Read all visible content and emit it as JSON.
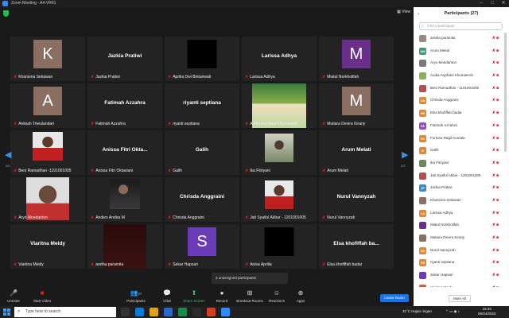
{
  "window": {
    "title": "Zoom Meeting - A4-VR61",
    "view_label": "View"
  },
  "tiles": [
    {
      "name": "Kharisma Setiawan",
      "avatar": "K",
      "avatar_color": "#8a6e62"
    },
    {
      "name": "Jazkia Pratiwi",
      "big": "Jazkia Pratiwi"
    },
    {
      "name": "Aprilia Dwi Bintariwati",
      "black": true
    },
    {
      "name": "Larissa Adhya",
      "big": "Larissa Adhya"
    },
    {
      "name": "Miatul Norkholifah",
      "avatar": "M",
      "avatar_color": "#6a2f8a"
    },
    {
      "name": "Aniisah Triwulandari",
      "avatar": "A",
      "avatar_color": "#8a6e62"
    },
    {
      "name": "Fatimah Azzahra",
      "big": "Fatimah Azzahra"
    },
    {
      "name": "riyanti septiana",
      "big": "riyanti septiana"
    },
    {
      "name": "Audia Asyifatul Khumaeroh",
      "photo": "poster"
    },
    {
      "name": "Mutiara Devira Kirany",
      "avatar": "M",
      "avatar_color": "#8a6e62"
    },
    {
      "name": "Beni Ramadhan -1191001005",
      "photo": "red-shirt"
    },
    {
      "name": "Anissa Fitri Oktaviani",
      "big": "Anissa Fitri Okta..."
    },
    {
      "name": "Galih",
      "big": "Galih"
    },
    {
      "name": "Ika Fitriyani",
      "photo": "outdoor"
    },
    {
      "name": "Arum Melati",
      "big": "Arum Melati"
    },
    {
      "name": "Aryo Moedanton",
      "photo": "man-glasses"
    },
    {
      "name": "Andien Andira M",
      "photo": "dark-room"
    },
    {
      "name": "Chrisda Anggraini",
      "big": "Chrisda Anggraini"
    },
    {
      "name": "Jati Syaiful Akbar - 1201001005",
      "photo": "red-shirt-2"
    },
    {
      "name": "Nurul Vannyzah",
      "big": "Nurul Vannyzah"
    },
    {
      "name": "Viaritna Meidy",
      "big": "Viaritna Meidy"
    },
    {
      "name": "aretha paramita",
      "photo": "dark-maroon"
    },
    {
      "name": "Sekar Hapsari",
      "avatar": "S",
      "avatar_color": "#6a3cb8"
    },
    {
      "name": "Anisa Aprilia",
      "black": true
    },
    {
      "name": "Elsa khofiffah badar",
      "big": "Elsa khofiffah ba..."
    }
  ],
  "pager": {
    "left": "2/2",
    "right": "2/2"
  },
  "toast": "3 unassigned participants",
  "toolbar": {
    "unmute": "Unmute",
    "start_video": "Start Video",
    "participants": "Participants",
    "participants_count": "27",
    "chat": "Chat",
    "share_screen": "Share Screen",
    "record": "Record",
    "breakout": "Breakout Rooms",
    "reactions": "Reactions",
    "apps": "Apps",
    "leave": "Leave Room"
  },
  "panel": {
    "title": "Participants (27)",
    "search_placeholder": "Find a participant",
    "mute_all": "Mute All",
    "participants": [
      {
        "initials": "",
        "color": "#9a8a80",
        "name": "aretha paramita"
      },
      {
        "initials": "AM",
        "color": "#3f9b6e",
        "name": "Arum Melati"
      },
      {
        "initials": "",
        "color": "#7a7a7a",
        "name": "Aryo Moedanton"
      },
      {
        "initials": "",
        "color": "#8fb05a",
        "name": "Audia Asyifatul Khumaeroh"
      },
      {
        "initials": "",
        "color": "#b05050",
        "name": "Beni Ramadhan - 1191001005"
      },
      {
        "initials": "CA",
        "color": "#e0873a",
        "name": "Chrisda Anggraini"
      },
      {
        "initials": "EB",
        "color": "#e0873a",
        "name": "Elsa khofiffah badar"
      },
      {
        "initials": "FA",
        "color": "#8e4fc0",
        "name": "Fatimah Azzahra"
      },
      {
        "initials": "FK",
        "color": "#e0873a",
        "name": "Fortuna Ragil Kumala"
      },
      {
        "initials": "G",
        "color": "#e0873a",
        "name": "Galih"
      },
      {
        "initials": "",
        "color": "#6a8a5a",
        "name": "Ika Fitriyani"
      },
      {
        "initials": "",
        "color": "#b05050",
        "name": "Jati Syaiful Akbar - 1201001005"
      },
      {
        "initials": "JP",
        "color": "#3a8ac0",
        "name": "Jazkia Pratiwi"
      },
      {
        "initials": "",
        "color": "#8a6e62",
        "name": "Kharisma Setiawan"
      },
      {
        "initials": "LA",
        "color": "#e0873a",
        "name": "Larissa Adhya"
      },
      {
        "initials": "",
        "color": "#6a2f8a",
        "name": "Miatul Norkholifah"
      },
      {
        "initials": "",
        "color": "#8a6e62",
        "name": "Mutiara Devira Kirany"
      },
      {
        "initials": "NV",
        "color": "#e0873a",
        "name": "Nurul Vannyzah"
      },
      {
        "initials": "RS",
        "color": "#e0873a",
        "name": "riyanti septiana"
      },
      {
        "initials": "",
        "color": "#6a3cb8",
        "name": "Sekar Hapsari"
      },
      {
        "initials": "VM",
        "color": "#d0603a",
        "name": "Viaritna Meidy"
      }
    ]
  },
  "taskbar": {
    "search_placeholder": "Type here to search",
    "weather": "31°C  Hujan ringan",
    "time": "15:45",
    "date": "06/04/2022"
  }
}
